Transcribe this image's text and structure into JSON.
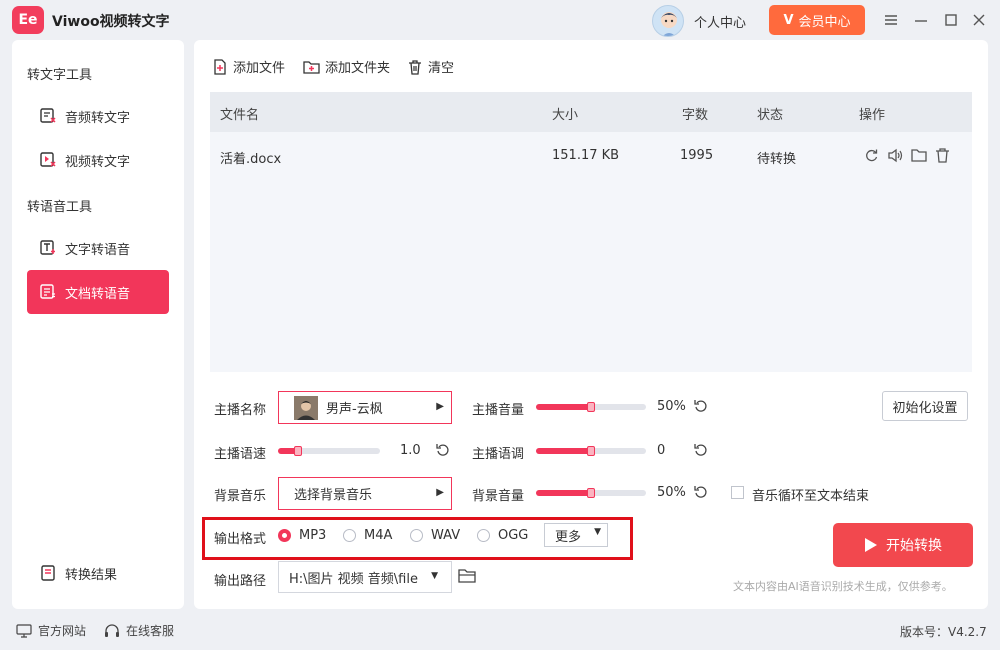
{
  "app": {
    "logo_text": "Ee",
    "title": "Viwoo视频转文字"
  },
  "header": {
    "profile_label": "个人中心",
    "vip_label": "会员中心"
  },
  "sidebar": {
    "section1": "转文字工具",
    "items1": [
      {
        "label": "音频转文字",
        "icon": "audio-text-icon"
      },
      {
        "label": "视频转文字",
        "icon": "video-text-icon"
      }
    ],
    "section2": "转语音工具",
    "items2": [
      {
        "label": "文字转语音",
        "icon": "text-voice-icon"
      },
      {
        "label": "文档转语音",
        "icon": "doc-voice-icon",
        "active": true
      }
    ],
    "result_label": "转换结果"
  },
  "toolbar": {
    "add_file": "添加文件",
    "add_folder": "添加文件夹",
    "clear": "清空"
  },
  "table": {
    "columns": [
      "文件名",
      "大小",
      "字数",
      "状态",
      "操作"
    ],
    "rows": [
      {
        "name": "活着.docx",
        "size": "151.17 KB",
        "words": "1995",
        "status": "待转换"
      }
    ]
  },
  "settings": {
    "anchor_label": "主播名称",
    "anchor_value": "男声-云枫",
    "volume_label": "主播音量",
    "volume_value": "50%",
    "volume_fraction": 0.5,
    "reset_label": "初始化设置",
    "speed_label": "主播语速",
    "speed_value": "1.0",
    "speed_fraction": 0.2,
    "pitch_label": "主播语调",
    "pitch_value": "0",
    "pitch_fraction": 0.5,
    "bgm_label": "背景音乐",
    "bgm_value": "选择背景音乐",
    "bg_volume_label": "背景音量",
    "bg_volume_value": "50%",
    "bg_volume_fraction": 0.5,
    "loop_label": "音乐循环至文本结束"
  },
  "output": {
    "format_label": "输出格式",
    "formats": [
      "MP3",
      "M4A",
      "WAV",
      "OGG"
    ],
    "selected": "MP3",
    "more_label": "更多",
    "path_label": "输出路径",
    "path_value": "H:\\图片 视频 音频\\file",
    "start_label": "开始转换",
    "disclaimer": "文本内容由AI语音识别技术生成，仅供参考。"
  },
  "footer": {
    "website": "官方网站",
    "support": "在线客服",
    "version": "版本号：V4.2.7"
  },
  "colors": {
    "accent": "#f2365a",
    "vip": "#ff6a3d",
    "start": "#f2484e"
  }
}
